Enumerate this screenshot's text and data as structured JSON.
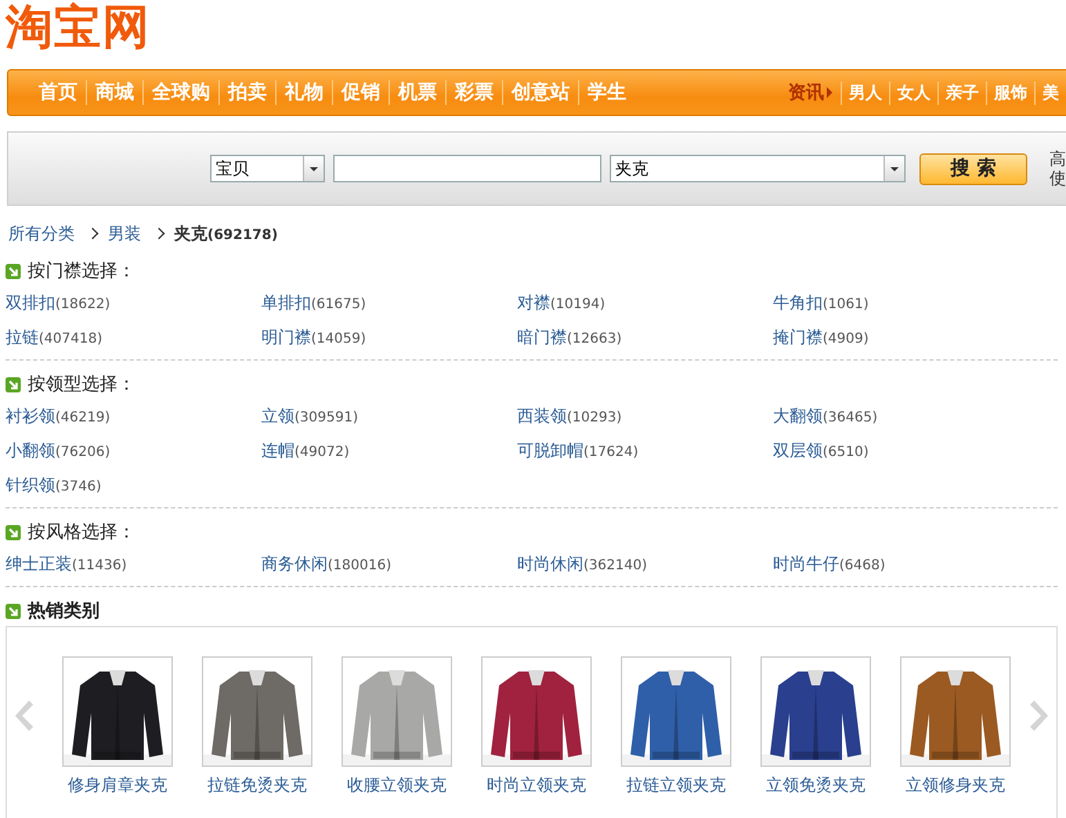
{
  "logo": "淘宝网",
  "nav": {
    "items": [
      "首页",
      "商城",
      "全球购",
      "拍卖",
      "礼物",
      "促销",
      "机票",
      "彩票",
      "创意站",
      "学生"
    ],
    "side_label": "资讯",
    "side_items": [
      "男人",
      "女人",
      "亲子",
      "服饰",
      "美"
    ]
  },
  "search": {
    "scope": "宝贝",
    "category": "夹克",
    "button": "搜 索",
    "side_text": [
      "高",
      "使"
    ]
  },
  "breadcrumb": [
    {
      "label": "所有分类",
      "current": false
    },
    {
      "label": "男装",
      "current": false
    },
    {
      "label": "夹克",
      "count": "(692178)",
      "current": true
    }
  ],
  "filters": [
    {
      "title": "按门襟选择：",
      "options": [
        {
          "label": "双排扣",
          "count": "(18622)"
        },
        {
          "label": "单排扣",
          "count": "(61675)"
        },
        {
          "label": "对襟",
          "count": "(10194)"
        },
        {
          "label": "牛角扣",
          "count": "(1061)"
        },
        {
          "label": "拉链",
          "count": "(407418)"
        },
        {
          "label": "明门襟",
          "count": "(14059)"
        },
        {
          "label": "暗门襟",
          "count": "(12663)"
        },
        {
          "label": "掩门襟",
          "count": "(4909)"
        }
      ]
    },
    {
      "title": "按领型选择：",
      "options": [
        {
          "label": "衬衫领",
          "count": "(46219)"
        },
        {
          "label": "立领",
          "count": "(309591)"
        },
        {
          "label": "西装领",
          "count": "(10293)"
        },
        {
          "label": "大翻领",
          "count": "(36465)"
        },
        {
          "label": "小翻领",
          "count": "(76206)"
        },
        {
          "label": "连帽",
          "count": "(49072)"
        },
        {
          "label": "可脱卸帽",
          "count": "(17624)"
        },
        {
          "label": "双层领",
          "count": "(6510)"
        },
        {
          "label": "针织领",
          "count": "(3746)"
        }
      ]
    },
    {
      "title": "按风格选择：",
      "options": [
        {
          "label": "绅士正装",
          "count": "(11436)"
        },
        {
          "label": "商务休闲",
          "count": "(180016)"
        },
        {
          "label": "时尚休闲",
          "count": "(362140)"
        },
        {
          "label": "时尚牛仔",
          "count": "(6468)"
        }
      ]
    }
  ],
  "hot": {
    "title": "热销类别",
    "products": [
      {
        "name": "修身肩章夹克",
        "kind": "picture"
      },
      {
        "name": "拉链免烫夹克",
        "kind": "picture"
      },
      {
        "name": "收腰立领夹克",
        "kind": "picture"
      },
      {
        "name": "时尚立领夹克",
        "kind": "picture"
      },
      {
        "name": "拉链立领夹克",
        "kind": "picture"
      },
      {
        "name": "立领免烫夹克",
        "kind": "picture"
      },
      {
        "name": "立领修身夹克",
        "kind": "picture"
      }
    ]
  }
}
